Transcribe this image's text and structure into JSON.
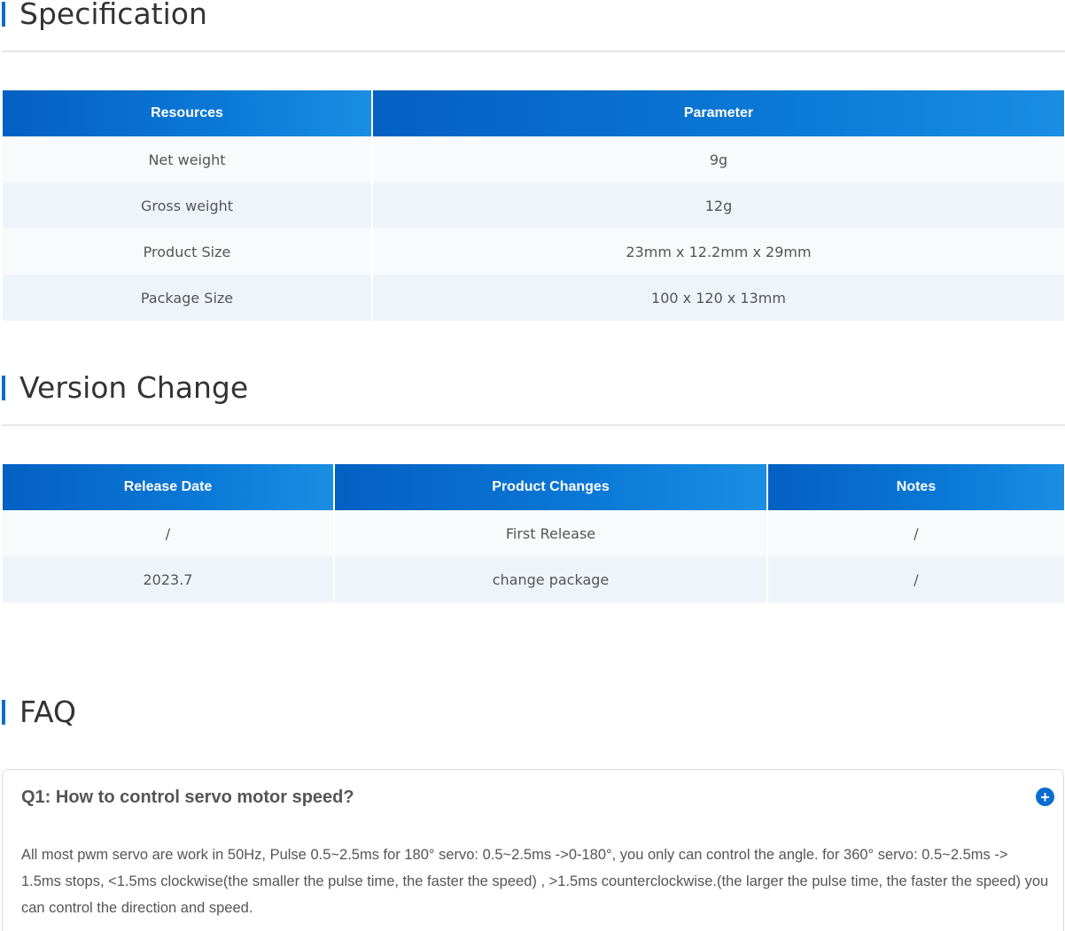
{
  "specification": {
    "title": "Specification",
    "headers": [
      "Resources",
      "Parameter"
    ],
    "rows": [
      [
        "Net weight",
        "9g"
      ],
      [
        "Gross weight",
        "12g"
      ],
      [
        "Product Size",
        "23mm x 12.2mm x 29mm"
      ],
      [
        "Package Size",
        "100 x 120 x 13mm"
      ]
    ]
  },
  "version_change": {
    "title": "Version Change",
    "headers": [
      "Release Date",
      "Product Changes",
      "Notes"
    ],
    "rows": [
      [
        "/",
        "First Release",
        "/"
      ],
      [
        "2023.7",
        "change package",
        "/"
      ]
    ]
  },
  "faq": {
    "title": "FAQ",
    "items": [
      {
        "question": "Q1: How to control servo motor speed?",
        "toggle_icon": "plus-circle-icon",
        "toggle_symbol": "+",
        "answer": "All most pwm servo are work in 50Hz, Pulse 0.5~2.5ms for 180° servo: 0.5~2.5ms ->0-180°, you only can control the angle. for 360° servo: 0.5~2.5ms -> 1.5ms stops, <1.5ms clockwise(the smaller the pulse time, the faster the speed) , >1.5ms counterclockwise.(the larger the pulse time, the faster the speed) you can control the direction and speed."
      }
    ]
  },
  "colors": {
    "accent": "#0a6cd1",
    "header_gradient_start": "#0460c3",
    "header_gradient_end": "#1a8ee3",
    "row_odd": "#f8fafc",
    "row_even": "#eef4fa"
  }
}
